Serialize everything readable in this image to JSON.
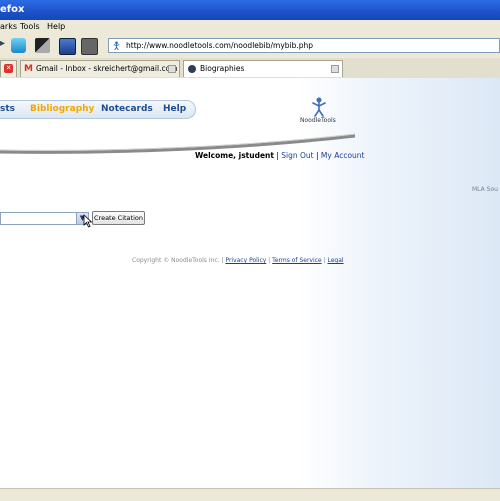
{
  "window": {
    "title": "efox"
  },
  "menu": {
    "items": [
      "arks",
      "Tools",
      "Help"
    ]
  },
  "address_bar": {
    "url": "http://www.noodletools.com/noodlebib/mybib.php"
  },
  "tabs": [
    {
      "label": "Gmail - Inbox - skreichert@gmail.com"
    },
    {
      "label": "Biographies"
    }
  ],
  "nav": {
    "items": [
      "sts",
      "Bibliography",
      "Notecards",
      "Help"
    ]
  },
  "logo": {
    "text": "NoodleTools"
  },
  "welcome": {
    "greeting": "Welcome, jstudent",
    "sep1": " | ",
    "sign_out": "Sign Out",
    "sep2": " | ",
    "my_account": "My Account"
  },
  "side_label": "MLA Sou",
  "citation": {
    "button_label": "Create Citation"
  },
  "footer": {
    "copyright": "Copyright © NoodleTools Inc. | ",
    "privacy": "Privacy Policy",
    "sep1": " | ",
    "terms": "Terms of Service",
    "sep2": " | ",
    "legal": "Legal"
  },
  "colors": {
    "nav_text": "#1f4e8f",
    "nav_active": "#f0a800",
    "link": "#1a3f99"
  }
}
